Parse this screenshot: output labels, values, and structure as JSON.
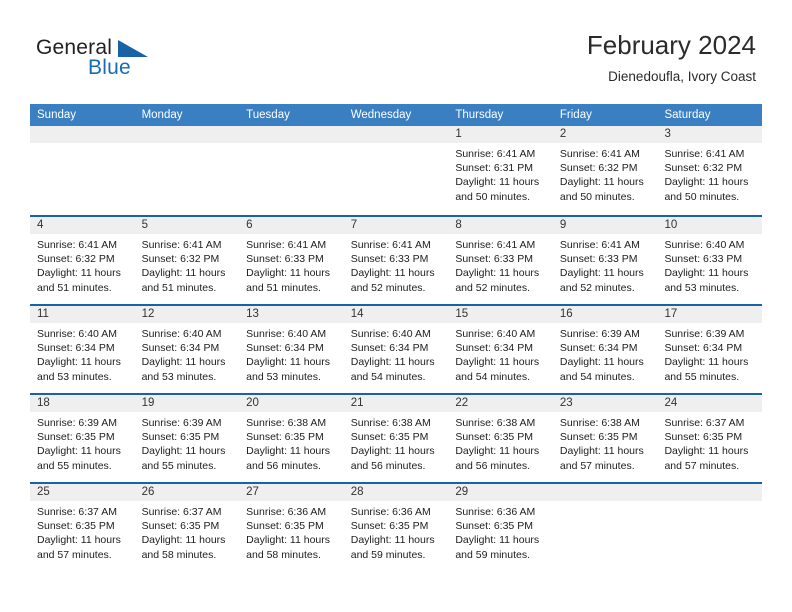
{
  "brand": {
    "name_part1": "General",
    "name_part2": "Blue",
    "flag_icon": "triangle-flag-icon",
    "accent_color": "#1763a6"
  },
  "header": {
    "title": "February 2024",
    "subtitle": "Dienedoufla, Ivory Coast"
  },
  "theme": {
    "header_row_bg": "#3a7fc1",
    "row_divider": "#1763a6",
    "day_head_bg": "#efefef",
    "text": "#1d1d1d"
  },
  "weekdays": [
    "Sunday",
    "Monday",
    "Tuesday",
    "Wednesday",
    "Thursday",
    "Friday",
    "Saturday"
  ],
  "weeks": [
    [
      {
        "day": "",
        "lines": []
      },
      {
        "day": "",
        "lines": []
      },
      {
        "day": "",
        "lines": []
      },
      {
        "day": "",
        "lines": []
      },
      {
        "day": "1",
        "lines": [
          "Sunrise: 6:41 AM",
          "Sunset: 6:31 PM",
          "Daylight: 11 hours",
          "and 50 minutes."
        ]
      },
      {
        "day": "2",
        "lines": [
          "Sunrise: 6:41 AM",
          "Sunset: 6:32 PM",
          "Daylight: 11 hours",
          "and 50 minutes."
        ]
      },
      {
        "day": "3",
        "lines": [
          "Sunrise: 6:41 AM",
          "Sunset: 6:32 PM",
          "Daylight: 11 hours",
          "and 50 minutes."
        ]
      }
    ],
    [
      {
        "day": "4",
        "lines": [
          "Sunrise: 6:41 AM",
          "Sunset: 6:32 PM",
          "Daylight: 11 hours",
          "and 51 minutes."
        ]
      },
      {
        "day": "5",
        "lines": [
          "Sunrise: 6:41 AM",
          "Sunset: 6:32 PM",
          "Daylight: 11 hours",
          "and 51 minutes."
        ]
      },
      {
        "day": "6",
        "lines": [
          "Sunrise: 6:41 AM",
          "Sunset: 6:33 PM",
          "Daylight: 11 hours",
          "and 51 minutes."
        ]
      },
      {
        "day": "7",
        "lines": [
          "Sunrise: 6:41 AM",
          "Sunset: 6:33 PM",
          "Daylight: 11 hours",
          "and 52 minutes."
        ]
      },
      {
        "day": "8",
        "lines": [
          "Sunrise: 6:41 AM",
          "Sunset: 6:33 PM",
          "Daylight: 11 hours",
          "and 52 minutes."
        ]
      },
      {
        "day": "9",
        "lines": [
          "Sunrise: 6:41 AM",
          "Sunset: 6:33 PM",
          "Daylight: 11 hours",
          "and 52 minutes."
        ]
      },
      {
        "day": "10",
        "lines": [
          "Sunrise: 6:40 AM",
          "Sunset: 6:33 PM",
          "Daylight: 11 hours",
          "and 53 minutes."
        ]
      }
    ],
    [
      {
        "day": "11",
        "lines": [
          "Sunrise: 6:40 AM",
          "Sunset: 6:34 PM",
          "Daylight: 11 hours",
          "and 53 minutes."
        ]
      },
      {
        "day": "12",
        "lines": [
          "Sunrise: 6:40 AM",
          "Sunset: 6:34 PM",
          "Daylight: 11 hours",
          "and 53 minutes."
        ]
      },
      {
        "day": "13",
        "lines": [
          "Sunrise: 6:40 AM",
          "Sunset: 6:34 PM",
          "Daylight: 11 hours",
          "and 53 minutes."
        ]
      },
      {
        "day": "14",
        "lines": [
          "Sunrise: 6:40 AM",
          "Sunset: 6:34 PM",
          "Daylight: 11 hours",
          "and 54 minutes."
        ]
      },
      {
        "day": "15",
        "lines": [
          "Sunrise: 6:40 AM",
          "Sunset: 6:34 PM",
          "Daylight: 11 hours",
          "and 54 minutes."
        ]
      },
      {
        "day": "16",
        "lines": [
          "Sunrise: 6:39 AM",
          "Sunset: 6:34 PM",
          "Daylight: 11 hours",
          "and 54 minutes."
        ]
      },
      {
        "day": "17",
        "lines": [
          "Sunrise: 6:39 AM",
          "Sunset: 6:34 PM",
          "Daylight: 11 hours",
          "and 55 minutes."
        ]
      }
    ],
    [
      {
        "day": "18",
        "lines": [
          "Sunrise: 6:39 AM",
          "Sunset: 6:35 PM",
          "Daylight: 11 hours",
          "and 55 minutes."
        ]
      },
      {
        "day": "19",
        "lines": [
          "Sunrise: 6:39 AM",
          "Sunset: 6:35 PM",
          "Daylight: 11 hours",
          "and 55 minutes."
        ]
      },
      {
        "day": "20",
        "lines": [
          "Sunrise: 6:38 AM",
          "Sunset: 6:35 PM",
          "Daylight: 11 hours",
          "and 56 minutes."
        ]
      },
      {
        "day": "21",
        "lines": [
          "Sunrise: 6:38 AM",
          "Sunset: 6:35 PM",
          "Daylight: 11 hours",
          "and 56 minutes."
        ]
      },
      {
        "day": "22",
        "lines": [
          "Sunrise: 6:38 AM",
          "Sunset: 6:35 PM",
          "Daylight: 11 hours",
          "and 56 minutes."
        ]
      },
      {
        "day": "23",
        "lines": [
          "Sunrise: 6:38 AM",
          "Sunset: 6:35 PM",
          "Daylight: 11 hours",
          "and 57 minutes."
        ]
      },
      {
        "day": "24",
        "lines": [
          "Sunrise: 6:37 AM",
          "Sunset: 6:35 PM",
          "Daylight: 11 hours",
          "and 57 minutes."
        ]
      }
    ],
    [
      {
        "day": "25",
        "lines": [
          "Sunrise: 6:37 AM",
          "Sunset: 6:35 PM",
          "Daylight: 11 hours",
          "and 57 minutes."
        ]
      },
      {
        "day": "26",
        "lines": [
          "Sunrise: 6:37 AM",
          "Sunset: 6:35 PM",
          "Daylight: 11 hours",
          "and 58 minutes."
        ]
      },
      {
        "day": "27",
        "lines": [
          "Sunrise: 6:36 AM",
          "Sunset: 6:35 PM",
          "Daylight: 11 hours",
          "and 58 minutes."
        ]
      },
      {
        "day": "28",
        "lines": [
          "Sunrise: 6:36 AM",
          "Sunset: 6:35 PM",
          "Daylight: 11 hours",
          "and 59 minutes."
        ]
      },
      {
        "day": "29",
        "lines": [
          "Sunrise: 6:36 AM",
          "Sunset: 6:35 PM",
          "Daylight: 11 hours",
          "and 59 minutes."
        ]
      },
      {
        "day": "",
        "lines": []
      },
      {
        "day": "",
        "lines": []
      }
    ]
  ]
}
